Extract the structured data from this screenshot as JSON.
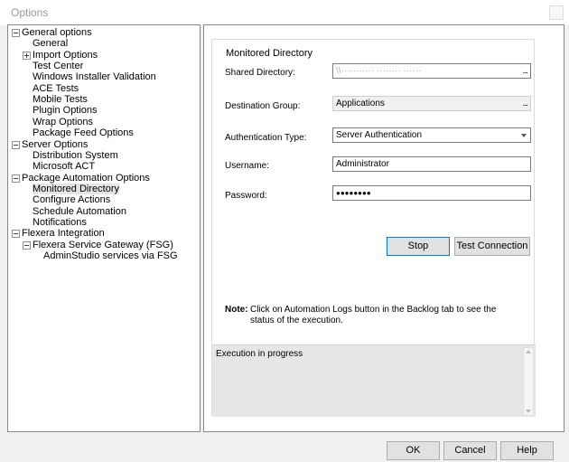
{
  "window": {
    "title": "Options"
  },
  "tree": {
    "nodes": [
      {
        "label": "General options",
        "level": 0,
        "expander": "minus"
      },
      {
        "label": "General",
        "level": 1,
        "expander": ""
      },
      {
        "label": "Import Options",
        "level": 1,
        "expander": "plus"
      },
      {
        "label": "Test Center",
        "level": 1,
        "expander": ""
      },
      {
        "label": "Windows Installer Validation",
        "level": 1,
        "expander": ""
      },
      {
        "label": "ACE Tests",
        "level": 1,
        "expander": ""
      },
      {
        "label": "Mobile Tests",
        "level": 1,
        "expander": ""
      },
      {
        "label": "Plugin Options",
        "level": 1,
        "expander": ""
      },
      {
        "label": "Wrap Options",
        "level": 1,
        "expander": ""
      },
      {
        "label": "Package Feed Options",
        "level": 1,
        "expander": ""
      },
      {
        "label": "Server Options",
        "level": 0,
        "expander": "minus"
      },
      {
        "label": "Distribution System",
        "level": 1,
        "expander": ""
      },
      {
        "label": "Microsoft ACT",
        "level": 1,
        "expander": ""
      },
      {
        "label": "Package Automation Options",
        "level": 0,
        "expander": "minus"
      },
      {
        "label": "Monitored Directory",
        "level": 1,
        "expander": "",
        "selected": true
      },
      {
        "label": "Configure Actions",
        "level": 1,
        "expander": ""
      },
      {
        "label": "Schedule Automation",
        "level": 1,
        "expander": ""
      },
      {
        "label": "Notifications",
        "level": 1,
        "expander": ""
      },
      {
        "label": "Flexera Integration",
        "level": 0,
        "expander": "minus"
      },
      {
        "label": "Flexera Service Gateway (FSG)",
        "level": 1,
        "expander": "minus"
      },
      {
        "label": "AdminStudio services via FSG",
        "level": 2,
        "expander": ""
      }
    ]
  },
  "panel": {
    "group_title": "Monitored Directory",
    "shared_directory": {
      "label": "Shared Directory:",
      "value": "\\\\···········  ········  ······"
    },
    "destination_group": {
      "label": "Destination Group:",
      "value": "Applications"
    },
    "auth_type": {
      "label": "Authentication Type:",
      "value": "Server Authentication"
    },
    "username": {
      "label": "Username:",
      "value": "Administrator"
    },
    "password": {
      "label": "Password:",
      "value": "●●●●●●●●"
    },
    "browse_label": "...",
    "stop_label": "Stop",
    "test_connection_label": "Test Connection",
    "note_label": "Note:",
    "note_text": "Click on Automation Logs button in the Backlog tab to see the status of the execution.",
    "log_text": "Execution in progress"
  },
  "footer": {
    "ok_label": "OK",
    "cancel_label": "Cancel",
    "help_label": "Help"
  }
}
